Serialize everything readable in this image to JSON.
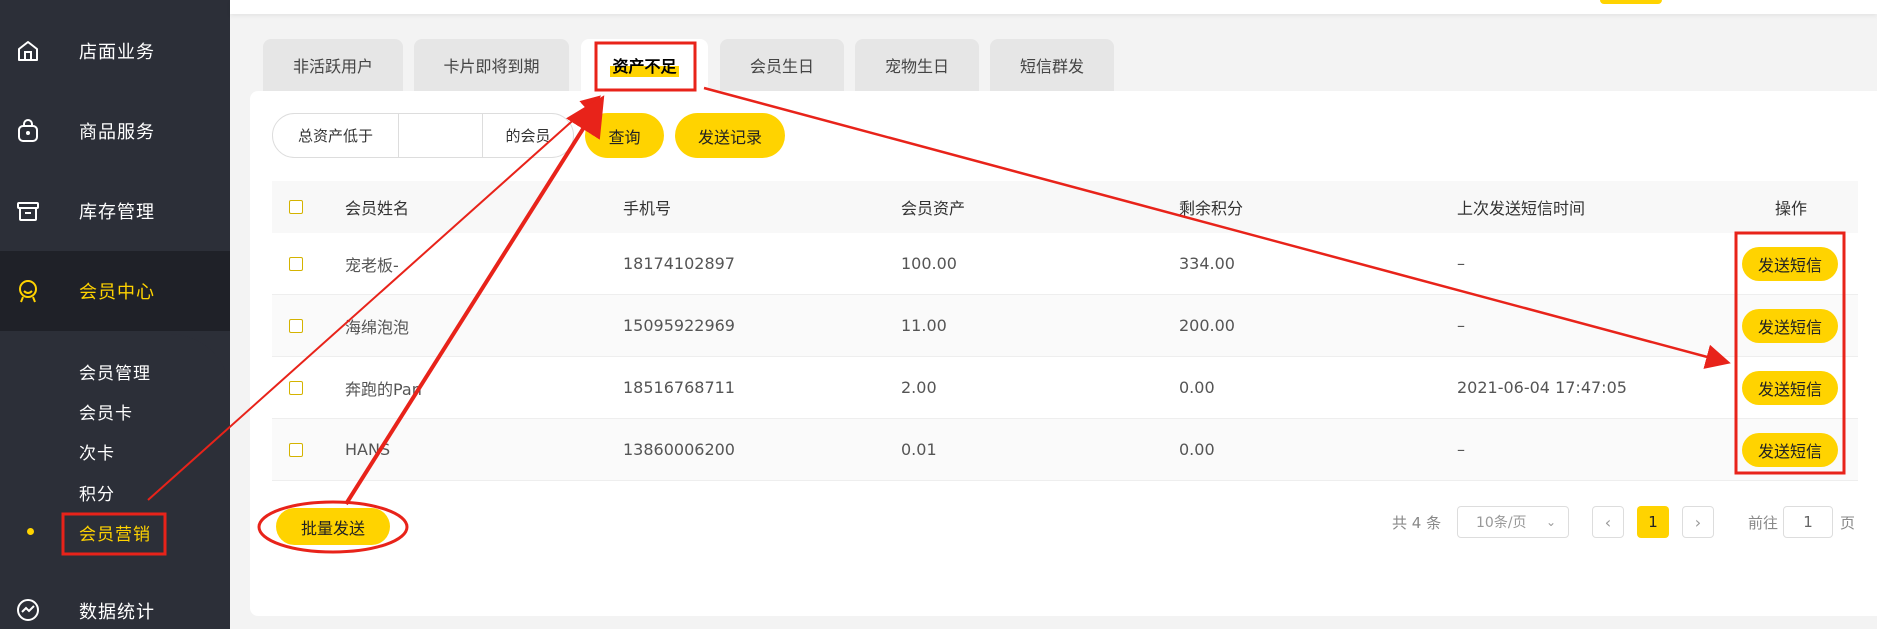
{
  "sidebar": {
    "items": [
      {
        "label": "店面业务",
        "icon": "home-icon"
      },
      {
        "label": "商品服务",
        "icon": "bag-icon"
      },
      {
        "label": "库存管理",
        "icon": "box-icon"
      },
      {
        "label": "会员中心",
        "icon": "member-icon"
      }
    ],
    "sub_items": [
      "会员管理",
      "会员卡",
      "次卡",
      "积分",
      "会员营销"
    ],
    "bottom_item": {
      "label": "数据统计",
      "icon": "chart-icon"
    }
  },
  "tabs": [
    "非活跃用户",
    "卡片即将到期",
    "资产不足",
    "会员生日",
    "宠物生日",
    "短信群发"
  ],
  "filter": {
    "prefix": "总资产低于",
    "value": "",
    "suffix": "的会员",
    "query_label": "查询",
    "record_label": "发送记录"
  },
  "table": {
    "headers": [
      "会员姓名",
      "手机号",
      "会员资产",
      "剩余积分",
      "上次发送短信时间",
      "操作"
    ],
    "rows": [
      {
        "name": "宠老板-",
        "phone": "18174102897",
        "assets": "100.00",
        "points": "334.00",
        "last_sms": "–",
        "action": "发送短信"
      },
      {
        "name": "海绵泡泡",
        "phone": "15095922969",
        "assets": "11.00",
        "points": "200.00",
        "last_sms": "–",
        "action": "发送短信"
      },
      {
        "name": "奔跑的Pan",
        "phone": "18516768711",
        "assets": "2.00",
        "points": "0.00",
        "last_sms": "2021-06-04 17:47:05",
        "action": "发送短信"
      },
      {
        "name": "HANS",
        "phone": "13860006200",
        "assets": "0.01",
        "points": "0.00",
        "last_sms": "–",
        "action": "发送短信"
      }
    ]
  },
  "batch_label": "批量发送",
  "pagination": {
    "total": "共 4 条",
    "page_size": "10条/页",
    "current": "1",
    "goto_label": "前往",
    "goto_value": "1",
    "page_suffix": "页"
  },
  "colors": {
    "accent": "#ffd300",
    "sidebar_bg": "#2c2f38",
    "annotation": "#e8231a"
  }
}
